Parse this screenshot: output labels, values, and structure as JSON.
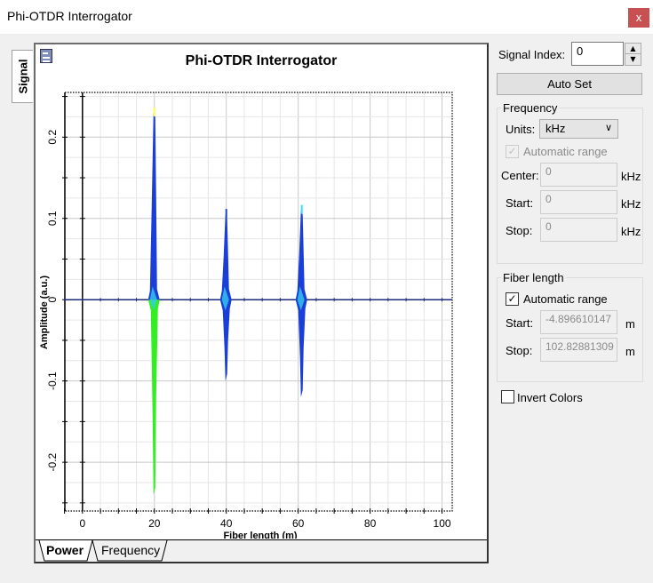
{
  "window": {
    "title": "Phi-OTDR Interrogator",
    "close_label": "x"
  },
  "side_tabs": [
    {
      "label": "Signal"
    }
  ],
  "plot": {
    "title": "Phi-OTDR Interrogator",
    "tabs": [
      {
        "label": "Power",
        "active": true
      },
      {
        "label": "Frequency",
        "active": false
      }
    ]
  },
  "chart_data": {
    "type": "line",
    "title": "Phi-OTDR Interrogator",
    "xlabel": "Fiber length (m)",
    "ylabel": "Amplitude (a.u.)",
    "xlim": [
      -4.8966,
      102.8288
    ],
    "ylim": [
      -0.26,
      0.255
    ],
    "x_ticks": [
      0,
      20,
      40,
      60,
      80,
      100
    ],
    "y_ticks": [
      -0.2,
      -0.1,
      0,
      0.1,
      0.2
    ],
    "grid": true,
    "baseline": 0,
    "events": [
      {
        "name": "event-20m",
        "x": 20,
        "max": 0.23,
        "min": -0.24,
        "upper_color": "#1a3fd8",
        "lower_color": "#33ee22",
        "tip_color": "#ffff44"
      },
      {
        "name": "event-40m",
        "x": 40,
        "max": 0.105,
        "min": -0.1,
        "upper_color": "#1a3fd8",
        "lower_color": "#1a3fd8",
        "tip_color": "#1a3fd8"
      },
      {
        "name": "event-61m",
        "x": 61,
        "max": 0.11,
        "min": -0.12,
        "upper_color": "#1a3fd8",
        "lower_color": "#1a3fd8",
        "tip_color": "#33ddff"
      }
    ]
  },
  "panel": {
    "signal_index_label": "Signal Index:",
    "signal_index_value": "0",
    "auto_set_label": "Auto Set",
    "frequency": {
      "group_label": "Frequency",
      "units_label": "Units:",
      "units_value": "kHz",
      "auto_range_label": "Automatic range",
      "auto_range_checked": true,
      "center_label": "Center:",
      "center_value": "0",
      "start_label": "Start:",
      "start_value": "0",
      "stop_label": "Stop:",
      "stop_value": "0",
      "unit": "kHz"
    },
    "fiber_length": {
      "group_label": "Fiber length",
      "auto_range_label": "Automatic range",
      "auto_range_checked": true,
      "start_label": "Start:",
      "start_value": "-4.896610147",
      "stop_label": "Stop:",
      "stop_value": "102.82881309",
      "unit": "m"
    },
    "invert_colors_label": "Invert Colors",
    "invert_colors_checked": false
  }
}
